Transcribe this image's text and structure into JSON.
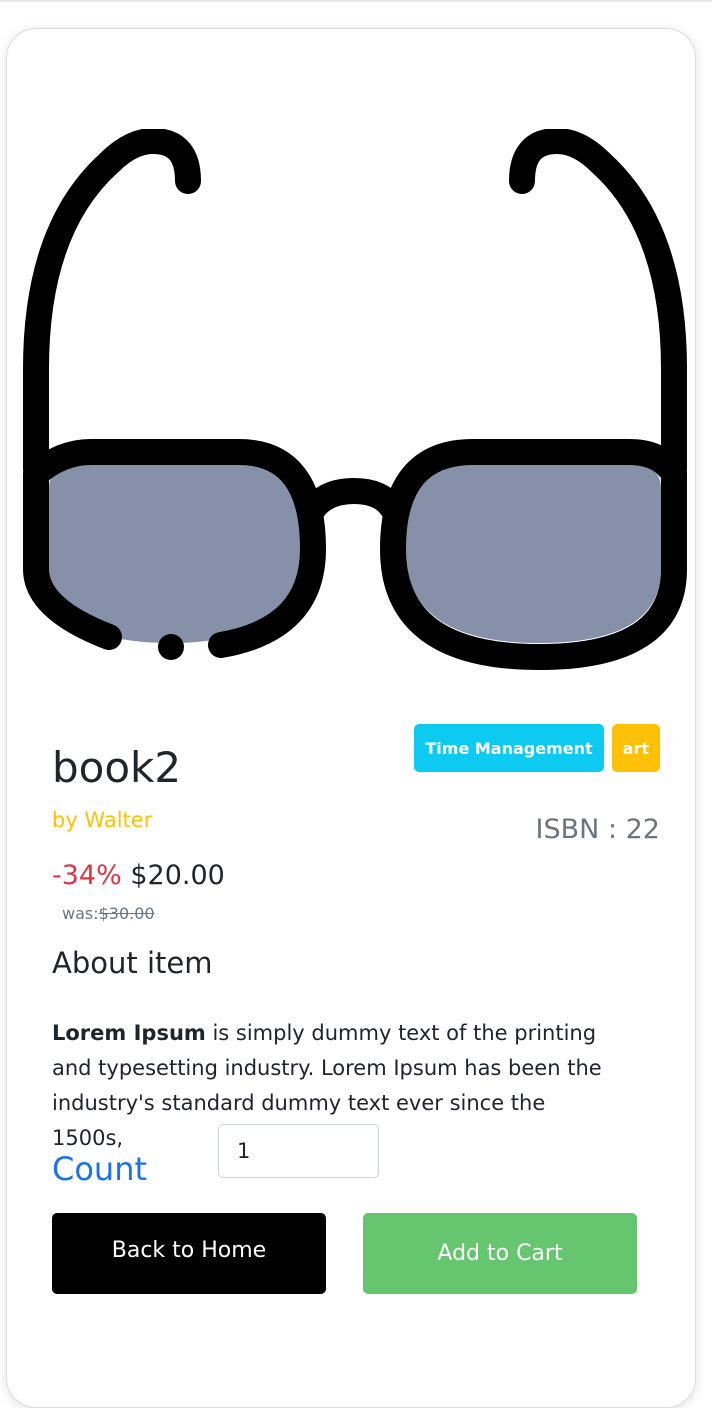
{
  "product": {
    "title": "book2",
    "author": "by Walter",
    "tags": [
      "Time Management",
      "art"
    ],
    "isbn": "ISBN : 22",
    "discount": "-34%",
    "price": "$20.00",
    "was_label": "was:",
    "was_price": "$30.00",
    "image_icon": "sunglasses-icon"
  },
  "about": {
    "heading": "About item",
    "desc_bold": "Lorem Ipsum",
    "desc_rest": " is simply dummy text of the printing and typesetting industry. Lorem Ipsum has been the industry's standard dummy text ever since the 1500s,"
  },
  "count": {
    "label": "Count",
    "value": "1"
  },
  "buttons": {
    "back_home": "Back to Home",
    "add_to_cart": "Add to Cart"
  },
  "colors": {
    "tag_time_management": "#0dcaf0",
    "tag_art": "#ffc107",
    "author": "#ffc107",
    "discount": "#dc3545",
    "count_label": "#1a73e8",
    "back_button": "#000000",
    "cart_button": "#66c56f",
    "lens": "#8690a8"
  }
}
